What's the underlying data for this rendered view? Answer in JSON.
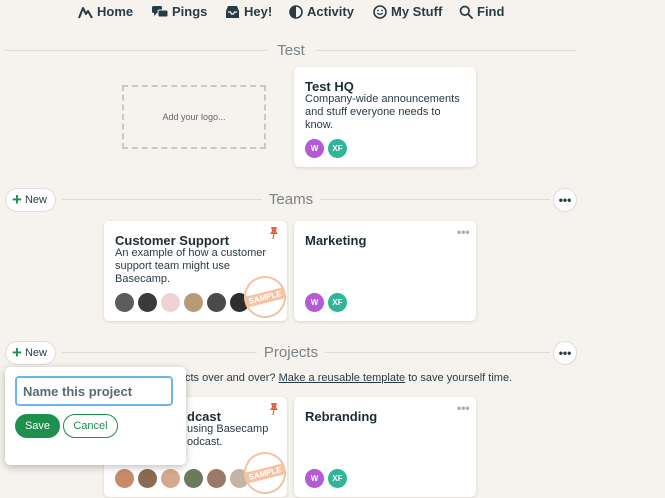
{
  "nav": {
    "home": "Home",
    "pings": "Pings",
    "hey": "Hey!",
    "activity": "Activity",
    "my_stuff": "My Stuff",
    "find": "Find"
  },
  "company": {
    "section_title": "Test",
    "logo_placeholder": "Add your logo...",
    "hq_card": {
      "title": "Test HQ",
      "description": "Company-wide announcements and stuff everyone needs to know.",
      "avatars": [
        {
          "initials": "W",
          "color": "#b45ad6"
        },
        {
          "initials": "XF",
          "color": "#2fb59a"
        }
      ]
    }
  },
  "teams": {
    "section_title": "Teams",
    "new_label": "New",
    "cards": [
      {
        "title": "Customer Support",
        "description": "An example of how a customer support team might use Basecamp.",
        "stamp": "SAMPLE"
      },
      {
        "title": "Marketing",
        "avatars": [
          {
            "initials": "W",
            "color": "#b45ad6"
          },
          {
            "initials": "XF",
            "color": "#2fb59a"
          }
        ]
      }
    ]
  },
  "projects": {
    "section_title": "Projects",
    "new_label": "New",
    "hint_prefix": "cts over and over?",
    "hint_link": "Make a reusable template",
    "hint_suffix": "to save yourself time.",
    "cards": [
      {
        "title_fragment": "dcast",
        "desc_fragment_1": "using Basecamp",
        "desc_fragment_2": "odcast.",
        "stamp": "SAMPLE"
      },
      {
        "title": "Rebranding",
        "avatars": [
          {
            "initials": "W",
            "color": "#b45ad6"
          },
          {
            "initials": "XF",
            "color": "#2fb59a"
          }
        ]
      }
    ]
  },
  "new_project_form": {
    "placeholder": "Name this project",
    "save_label": "Save",
    "cancel_label": "Cancel"
  },
  "colors": {
    "background": "#f6f2ee",
    "accent_green": "#1e8f4d",
    "input_focus": "#6fb6e8"
  }
}
